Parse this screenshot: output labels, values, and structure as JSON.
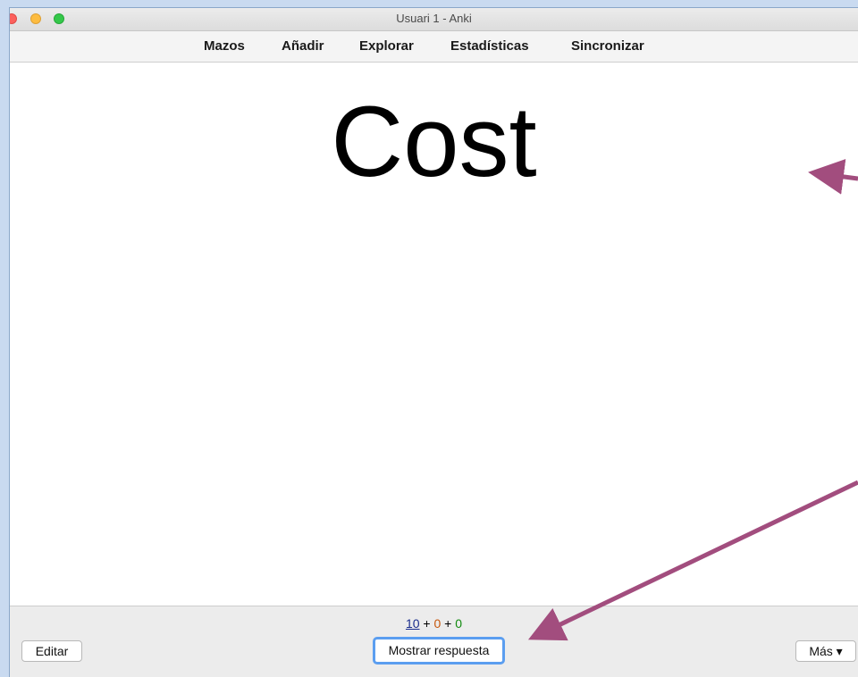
{
  "window": {
    "title": "Usuari 1 - Anki"
  },
  "toolbar": {
    "items": [
      "Mazos",
      "Añadir",
      "Explorar",
      "Estadísticas",
      "Sincronizar"
    ]
  },
  "card": {
    "front": "Cost"
  },
  "counts": {
    "new": "10",
    "plus1": " + ",
    "learning": "0",
    "plus2": " + ",
    "review": "0"
  },
  "buttons": {
    "edit": "Editar",
    "show_answer": "Mostrar respuesta",
    "more": "Más ▾"
  },
  "colors": {
    "annotation_arrow": "#a24d7e",
    "focus_ring": "#5b9ef0"
  }
}
